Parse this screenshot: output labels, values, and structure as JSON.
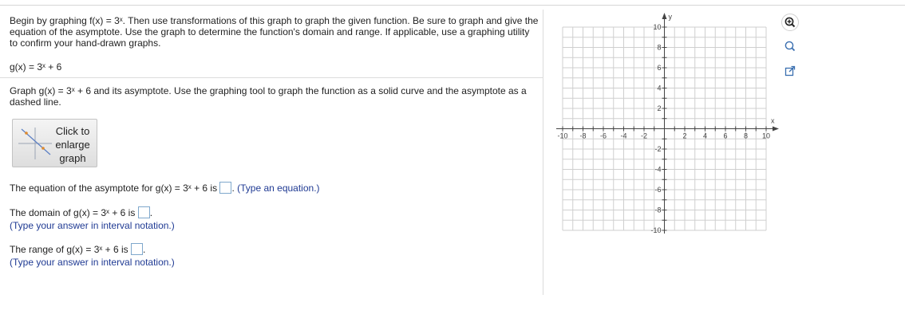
{
  "problem": {
    "prompt": "Begin by graphing f(x) = 3ˣ. Then use transformations of this graph to graph the given function. Be sure to graph and give the equation of the asymptote. Use the graph to determine the function's domain and range. If applicable, use a graphing utility to confirm your hand-drawn graphs.",
    "function_line": "g(x) = 3ˣ + 6",
    "graph_instruction": "Graph g(x) = 3ˣ + 6 and its asymptote. Use the graphing tool to graph the function as a solid curve and the asymptote as a dashed line."
  },
  "enlarge_button": {
    "label": "Click to enlarge graph"
  },
  "questions": {
    "asymptote_prefix": "The equation of the asymptote for g(x) = 3ˣ + 6 is",
    "asymptote_hint": "(Type an equation.)",
    "domain_prefix": "The domain of g(x) = 3ˣ + 6 is",
    "domain_hint": "(Type your answer in interval notation.)",
    "range_prefix": "The range of g(x) = 3ˣ + 6 is",
    "range_hint": "(Type your answer in interval notation.)",
    "period": "."
  },
  "graph": {
    "x_axis_label": "x",
    "y_axis_label": "y",
    "x_tick_labels": [
      "-10",
      "-8",
      "-6",
      "-4",
      "-2",
      "2",
      "4",
      "6",
      "8",
      "10"
    ],
    "y_tick_labels": [
      "10",
      "8",
      "6",
      "4",
      "2",
      "-2",
      "-4",
      "-6",
      "-8",
      "-10"
    ],
    "x_range": [
      -10,
      10
    ],
    "y_range": [
      -10,
      10
    ],
    "grid": true
  },
  "tools": [
    "zoom-in-icon",
    "zoom-out-icon",
    "popout-icon"
  ],
  "colors": {
    "hint_text": "#1f3a93",
    "input_border": "#7fa8cc",
    "grid": "#cfcfcf"
  }
}
